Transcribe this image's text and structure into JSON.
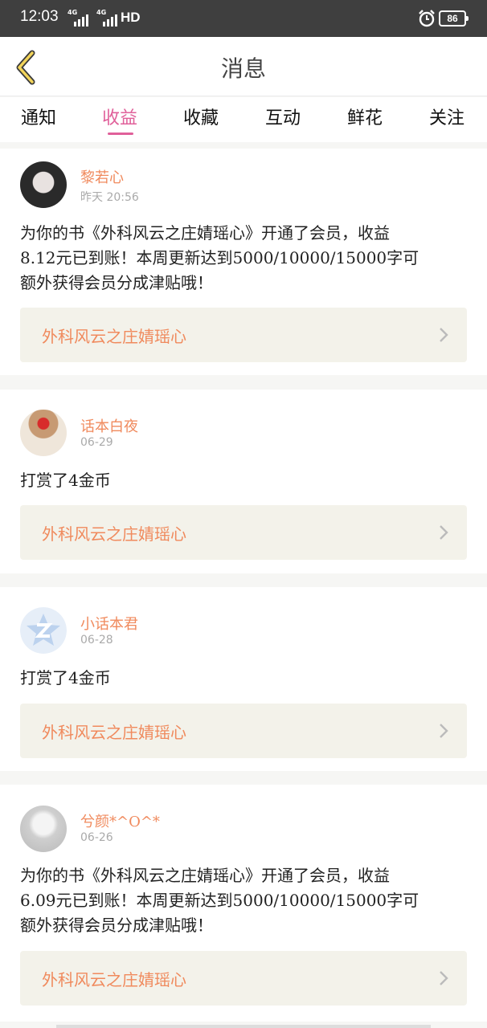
{
  "status": {
    "time": "12:03",
    "sig1": "4G",
    "sig2": "4G",
    "hd": "HD",
    "battery": "86"
  },
  "header": {
    "title": "消息"
  },
  "tabs": [
    {
      "label": "通知"
    },
    {
      "label": "收益",
      "active": true
    },
    {
      "label": "收藏"
    },
    {
      "label": "互动"
    },
    {
      "label": "鲜花"
    },
    {
      "label": "关注"
    }
  ],
  "messages": [
    {
      "user": "黎若心",
      "date": "昨天 20:56",
      "lines": [
        "为你的书《外科风云之庄婧瑶心》开通了会员，收益",
        "8.12元已到账！本周更新达到5000/10000/15000字可",
        "额外获得会员分成津贴哦！"
      ],
      "book": "外科风云之庄婧瑶心"
    },
    {
      "user": "话本白夜",
      "date": "06-29",
      "lines": [
        "打赏了4金币"
      ],
      "book": "外科风云之庄婧瑶心"
    },
    {
      "user": "小话本君",
      "date": "06-28",
      "lines": [
        "打赏了4金币"
      ],
      "book": "外科风云之庄婧瑶心"
    },
    {
      "user": "兮颜*^O^*",
      "date": "06-26",
      "lines": [
        "为你的书《外科风云之庄婧瑶心》开通了会员，收益",
        "6.09元已到账！本周更新达到5000/10000/15000字可",
        "额外获得会员分成津贴哦！"
      ],
      "book": "外科风云之庄婧瑶心"
    }
  ],
  "colors": {
    "accent": "#e0609a",
    "name": "#f08a5d",
    "link_bg": "#f3f2ea"
  }
}
